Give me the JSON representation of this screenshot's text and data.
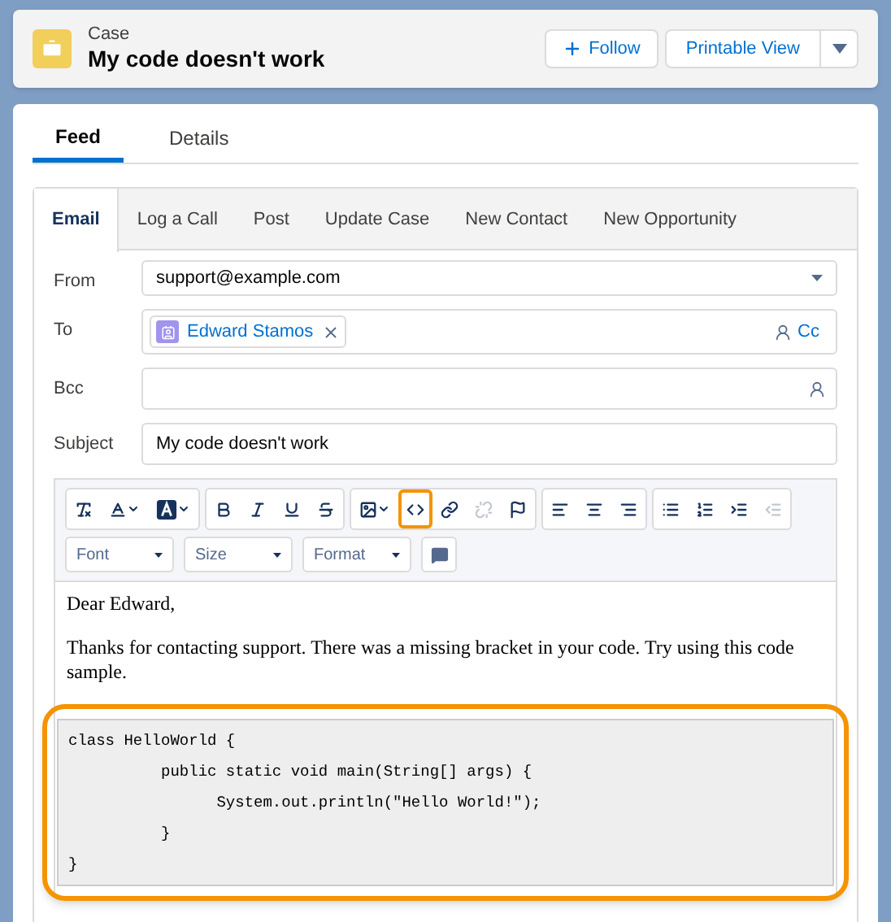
{
  "header": {
    "object_type": "Case",
    "title": "My code doesn't work",
    "buttons": [
      {
        "kind": "follow",
        "label": "Follow"
      },
      {
        "kind": "plain",
        "label": "Printable View"
      },
      {
        "kind": "menu"
      }
    ]
  },
  "record_tabs": [
    {
      "label": "Feed",
      "selected": true
    },
    {
      "label": "Details",
      "selected": false
    }
  ],
  "action_tabs": [
    {
      "label": "Email",
      "selected": true
    },
    {
      "label": "Log a Call",
      "selected": false
    },
    {
      "label": "Post",
      "selected": false
    },
    {
      "label": "Update Case",
      "selected": false
    },
    {
      "label": "New Contact",
      "selected": false
    },
    {
      "label": "New Opportunity",
      "selected": false
    }
  ],
  "form": {
    "from": {
      "label": "From",
      "value": "support@example.com"
    },
    "to": {
      "label": "To",
      "recipient": "Edward Stamos",
      "cc": "Cc"
    },
    "bcc": {
      "label": "Bcc"
    },
    "subject": {
      "label": "Subject",
      "value": "My code doesn't work"
    }
  },
  "toolbar": {
    "groups": [
      [
        {
          "kind": "clear-format",
          "disabled": false,
          "highlighted": false
        },
        {
          "kind": "text-color",
          "disabled": false,
          "highlighted": false
        },
        {
          "kind": "background-color",
          "disabled": false,
          "highlighted": false
        }
      ],
      [
        {
          "kind": "bold",
          "disabled": false,
          "highlighted": false
        },
        {
          "kind": "italic",
          "disabled": false,
          "highlighted": false
        },
        {
          "kind": "underline",
          "disabled": false,
          "highlighted": false
        },
        {
          "kind": "strikethrough",
          "disabled": false,
          "highlighted": false
        }
      ],
      [
        {
          "kind": "image",
          "disabled": false,
          "highlighted": false
        },
        {
          "kind": "code",
          "disabled": false,
          "highlighted": true
        },
        {
          "kind": "link",
          "disabled": false,
          "highlighted": false
        },
        {
          "kind": "unlink",
          "disabled": true,
          "highlighted": false
        },
        {
          "kind": "flag",
          "disabled": false,
          "highlighted": false
        }
      ],
      [
        {
          "kind": "align-left",
          "disabled": false,
          "highlighted": false
        },
        {
          "kind": "align-center",
          "disabled": false,
          "highlighted": false
        },
        {
          "kind": "align-right",
          "disabled": false,
          "highlighted": false
        }
      ],
      [
        {
          "kind": "bullets",
          "disabled": false,
          "highlighted": false
        },
        {
          "kind": "numbers",
          "disabled": false,
          "highlighted": false
        },
        {
          "kind": "indent",
          "disabled": false,
          "highlighted": false
        },
        {
          "kind": "outdent",
          "disabled": true,
          "highlighted": false
        }
      ]
    ],
    "dropdowns": [
      "Font",
      "Size",
      "Format"
    ]
  },
  "body": {
    "paragraphs": [
      "Dear Edward,",
      "Thanks for contacting support. There was a missing bracket in your code. Try using this code sample."
    ],
    "code_block": {
      "highlighted": true,
      "lines": [
        "class HelloWorld {",
        "          public static void main(String[] args) {",
        "                System.out.println(\"Hello World!\");",
        "          }",
        "}"
      ]
    }
  }
}
